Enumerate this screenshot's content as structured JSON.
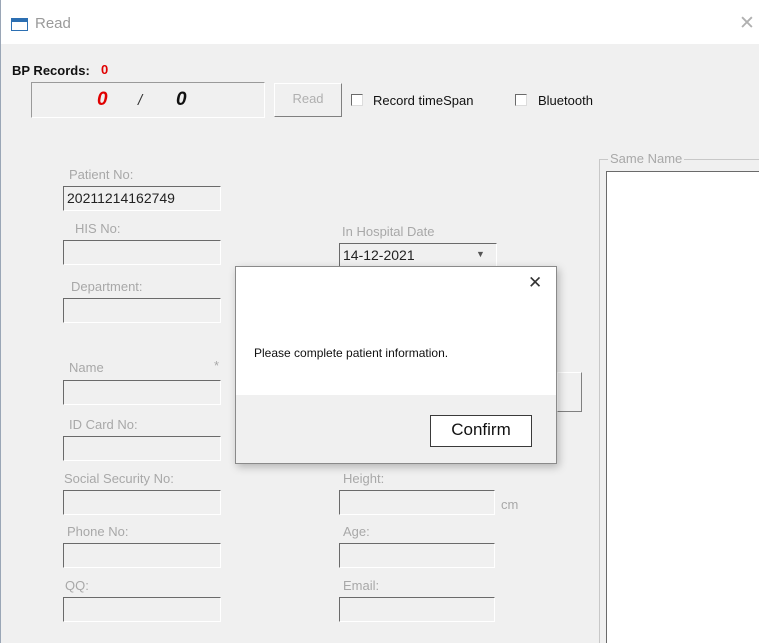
{
  "window": {
    "title": "Read",
    "close_icon": "close-icon"
  },
  "bp_records": {
    "label": "BP Records:",
    "count": "0",
    "current": "0",
    "separator": "/",
    "total": "0",
    "count_color": "#e00000",
    "current_color": "#e00000"
  },
  "toolbar": {
    "read_label": "Read",
    "record_timespan_label": "Record timeSpan",
    "bluetooth_label": "Bluetooth"
  },
  "form": {
    "patient_no_label": "Patient No:",
    "patient_no_value": "20211214162749",
    "his_no_label": "HIS No:",
    "his_no_value": "",
    "in_hospital_date_label": "In Hospital Date",
    "in_hospital_date_value": "14-12-2021",
    "department_label": "Department:",
    "department_value": "",
    "name_label": "Name",
    "name_required_mark": "*",
    "name_value": "",
    "id_card_label": "ID Card No:",
    "id_card_value": "",
    "social_security_label": "Social Security No:",
    "social_security_value": "",
    "height_label": "Height:",
    "height_value": "",
    "height_unit": "cm",
    "phone_label": "Phone No:",
    "phone_value": "",
    "age_label": "Age:",
    "age_value": "",
    "qq_label": "QQ:",
    "qq_value": "",
    "email_label": "Email:",
    "email_value": ""
  },
  "same_name": {
    "label": "Same Name"
  },
  "dialog": {
    "message": "Please complete patient information.",
    "confirm_label": "Confirm"
  }
}
